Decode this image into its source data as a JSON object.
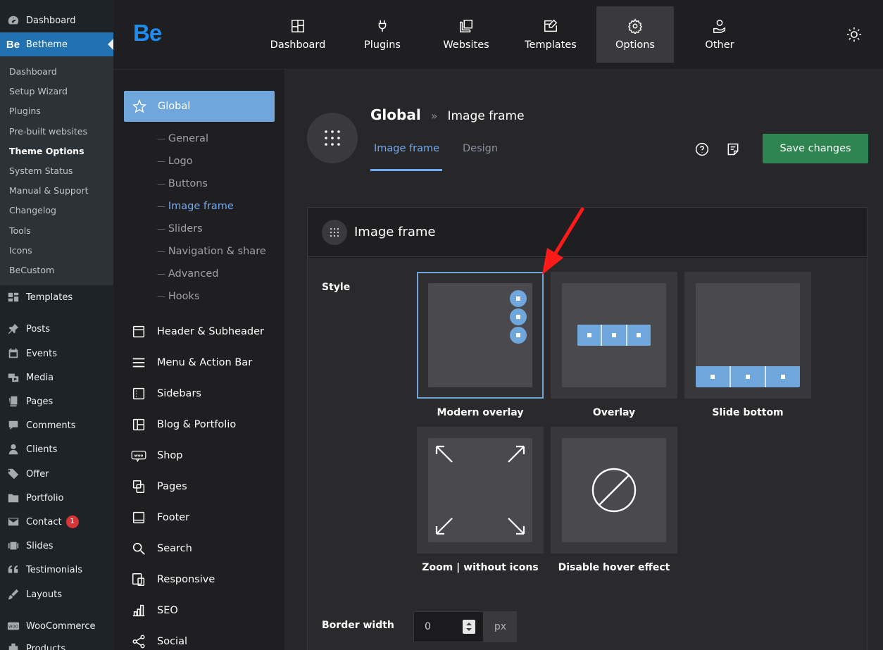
{
  "wp_menu": {
    "top": [
      {
        "label": "Dashboard",
        "icon": "dashboard-icon"
      },
      {
        "label": "Betheme",
        "icon": "betheme-logo-icon",
        "active": true
      }
    ],
    "betheme_sub": [
      {
        "label": "Dashboard"
      },
      {
        "label": "Setup Wizard"
      },
      {
        "label": "Plugins"
      },
      {
        "label": "Pre-built websites"
      },
      {
        "label": "Theme Options",
        "current": true
      },
      {
        "label": "System Status"
      },
      {
        "label": "Manual & Support"
      },
      {
        "label": "Changelog"
      },
      {
        "label": "Tools"
      },
      {
        "label": "Icons"
      },
      {
        "label": "BeCustom"
      }
    ],
    "rest": [
      {
        "label": "Templates",
        "icon": "templates-icon"
      },
      {
        "label": "Posts",
        "icon": "pin-icon"
      },
      {
        "label": "Events",
        "icon": "calendar-icon"
      },
      {
        "label": "Media",
        "icon": "media-icon"
      },
      {
        "label": "Pages",
        "icon": "page-icon"
      },
      {
        "label": "Comments",
        "icon": "comment-icon"
      },
      {
        "label": "Clients",
        "icon": "user-icon"
      },
      {
        "label": "Offer",
        "icon": "tag-icon"
      },
      {
        "label": "Portfolio",
        "icon": "folder-icon"
      },
      {
        "label": "Contact",
        "icon": "mail-icon",
        "badge": "1"
      },
      {
        "label": "Slides",
        "icon": "slides-icon"
      },
      {
        "label": "Testimonials",
        "icon": "quote-icon"
      },
      {
        "label": "Layouts",
        "icon": "brush-icon"
      },
      {
        "label": "WooCommerce",
        "icon": "woo-icon"
      },
      {
        "label": "Products",
        "icon": "product-icon"
      }
    ]
  },
  "topbar": {
    "logo": "Be",
    "nav": [
      {
        "label": "Dashboard",
        "icon": "dashboard-grid-icon"
      },
      {
        "label": "Plugins",
        "icon": "plug-icon"
      },
      {
        "label": "Websites",
        "icon": "websites-icon"
      },
      {
        "label": "Templates",
        "icon": "template-edit-icon"
      },
      {
        "label": "Options",
        "icon": "gear-icon",
        "active": true
      },
      {
        "label": "Other",
        "icon": "other-hand-icon"
      }
    ]
  },
  "options_nav": {
    "global_label": "Global",
    "global_sub": [
      {
        "label": "General"
      },
      {
        "label": "Logo"
      },
      {
        "label": "Buttons"
      },
      {
        "label": "Image frame",
        "current": true
      },
      {
        "label": "Sliders"
      },
      {
        "label": "Navigation & share"
      },
      {
        "label": "Advanced"
      },
      {
        "label": "Hooks"
      }
    ],
    "sections": [
      {
        "label": "Header & Subheader",
        "icon": "header-icon"
      },
      {
        "label": "Menu & Action Bar",
        "icon": "menu-icon"
      },
      {
        "label": "Sidebars",
        "icon": "sidebar-icon"
      },
      {
        "label": "Blog & Portfolio",
        "icon": "blog-icon"
      },
      {
        "label": "Shop",
        "icon": "woo-shop-icon"
      },
      {
        "label": "Pages",
        "icon": "pages-icon"
      },
      {
        "label": "Footer",
        "icon": "footer-icon"
      },
      {
        "label": "Search",
        "icon": "search-icon"
      },
      {
        "label": "Responsive",
        "icon": "responsive-icon"
      },
      {
        "label": "SEO",
        "icon": "seo-icon"
      },
      {
        "label": "Social",
        "icon": "share-icon"
      }
    ]
  },
  "header": {
    "crumb_main": "Global",
    "crumb_sep": "»",
    "crumb_sub": "Image frame",
    "tabs": [
      {
        "label": "Image frame",
        "active": true
      },
      {
        "label": "Design"
      }
    ],
    "save_label": "Save changes"
  },
  "panel": {
    "title": "Image frame",
    "style_label": "Style",
    "style_options": [
      {
        "label": "Modern overlay",
        "selected": true
      },
      {
        "label": "Overlay"
      },
      {
        "label": "Slide bottom"
      },
      {
        "label": "Zoom | without icons"
      },
      {
        "label": "Disable hover effect"
      }
    ],
    "border_label": "Border width",
    "border_value": "0",
    "border_unit": "px"
  },
  "colors": {
    "accent": "#72aaf0",
    "wp_active": "#2271b1",
    "save_green": "#2e8550",
    "annotation_arrow": "#ff1a1a"
  }
}
